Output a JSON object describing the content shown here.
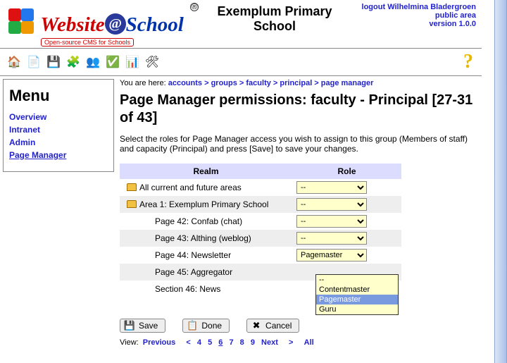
{
  "header": {
    "logo_main": "Website",
    "logo_sub": "School",
    "logo_tagline": "Open-source CMS for Schools",
    "site_title": "Exemplum Primary School",
    "logout_label": "logout",
    "username": "Wilhelmina Bladergroen",
    "public_area": "public area",
    "version": "version 1.0.0"
  },
  "toolbar": {
    "items": [
      {
        "name": "home-icon",
        "glyph": "🏠"
      },
      {
        "name": "page-icon",
        "glyph": "📄"
      },
      {
        "name": "save-icon",
        "glyph": "💾"
      },
      {
        "name": "modules-icon",
        "glyph": "🧩"
      },
      {
        "name": "users-icon",
        "glyph": "👥"
      },
      {
        "name": "check-icon",
        "glyph": "✅"
      },
      {
        "name": "stats-icon",
        "glyph": "📊"
      },
      {
        "name": "tools-icon",
        "glyph": "🛠"
      }
    ],
    "help_label": "?"
  },
  "menu": {
    "title": "Menu",
    "items": [
      {
        "label": "Overview",
        "active": false
      },
      {
        "label": "Intranet",
        "active": false
      },
      {
        "label": "Admin",
        "active": false
      },
      {
        "label": "Page Manager",
        "active": true
      }
    ]
  },
  "breadcrumb": {
    "prefix": "You are here:",
    "items": [
      "accounts",
      "groups",
      "faculty",
      "principal",
      "page manager"
    ]
  },
  "page": {
    "title": "Page Manager permissions: faculty - Principal [27-31 of 43]",
    "instructions": "Select the roles for Page Manager access you wish to assign to this group (Members of staff) and capacity (Principal) and press [Save] to save your changes."
  },
  "table": {
    "headers": {
      "realm": "Realm",
      "role": "Role"
    },
    "rows": [
      {
        "realm": "All current and future areas",
        "role": "--",
        "icon": "folder",
        "indent": 0
      },
      {
        "realm": "Area 1: Exemplum Primary School",
        "role": "--",
        "icon": "folder",
        "indent": 0
      },
      {
        "realm": "Page 42: Confab (chat)",
        "role": "--",
        "icon": "",
        "indent": 1
      },
      {
        "realm": "Page 43: Althing (weblog)",
        "role": "--",
        "icon": "",
        "indent": 1
      },
      {
        "realm": "Page 44: Newsletter",
        "role": "Pagemaster",
        "icon": "",
        "indent": 1,
        "open": true
      },
      {
        "realm": "Page 45: Aggregator",
        "role": "",
        "icon": "",
        "indent": 1
      },
      {
        "realm": "Section 46: News",
        "role": "",
        "icon": "",
        "indent": 1
      }
    ],
    "role_options": [
      "--",
      "Contentmaster",
      "Pagemaster",
      "Guru"
    ]
  },
  "buttons": {
    "save": "Save",
    "done": "Done",
    "cancel": "Cancel"
  },
  "pager": {
    "view_label": "View:",
    "previous": "Previous",
    "lt": "<",
    "pages": [
      "4",
      "5",
      "6",
      "7",
      "8",
      "9"
    ],
    "current": "6",
    "next": "Next",
    "gt": ">",
    "all": "All"
  }
}
